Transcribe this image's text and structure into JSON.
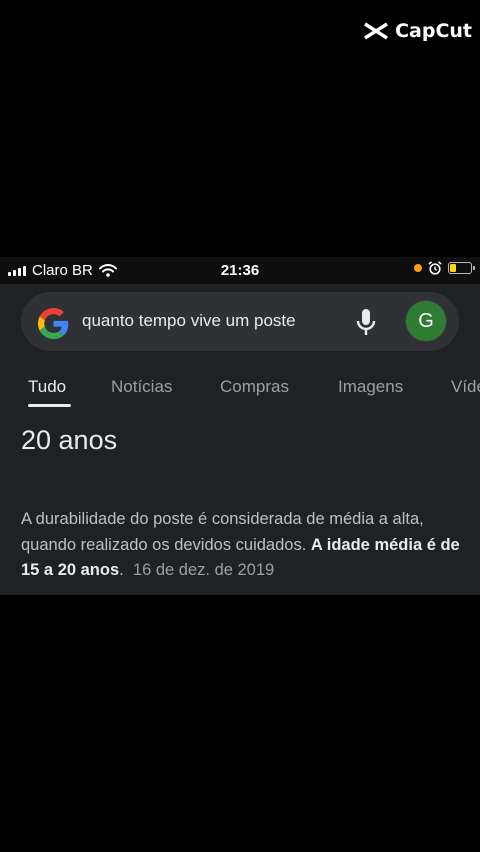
{
  "watermark": {
    "text": "CapCut"
  },
  "status_bar": {
    "carrier": "Claro BR",
    "time": "21:36",
    "battery_level": 0.3
  },
  "search": {
    "query": "quanto tempo vive um poste",
    "avatar_letter": "G"
  },
  "tabs": [
    "Tudo",
    "Notícias",
    "Compras",
    "Imagens",
    "Vídeos"
  ],
  "answer": {
    "title": "20 anos",
    "snippet_text": "A durabilidade do poste é considerada de média a alta, quando realizado os devidos cuidados. ",
    "snippet_bold": "A idade média é de 15 a 20 anos",
    "snippet_after": ".",
    "date": "16 de dez. de 2019"
  },
  "colors": {
    "accent": "#e8eaed",
    "avatar": "#2e7d32",
    "battery": "#ffd60a",
    "indicator": "#ff9f0a"
  }
}
